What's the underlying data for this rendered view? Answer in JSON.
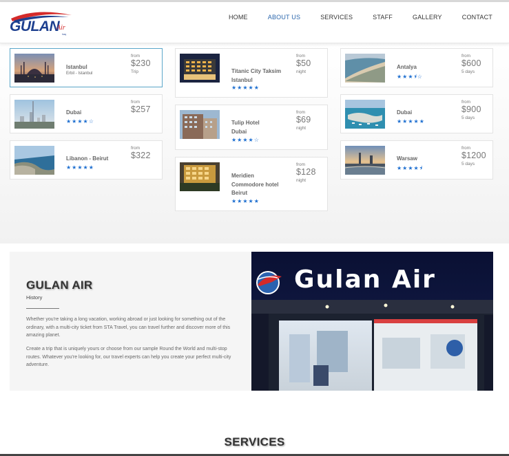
{
  "logo": {
    "text": "GULAN",
    "script": "Air",
    "tag": "Iraq"
  },
  "nav": [
    {
      "label": "HOME"
    },
    {
      "label": "ABOUT US",
      "active": true
    },
    {
      "label": "SERVICES"
    },
    {
      "label": "STAFF"
    },
    {
      "label": "GALLERY"
    },
    {
      "label": "CONTACT"
    }
  ],
  "deals": [
    {
      "name": "Istanbul",
      "sub": "Erbil - Istanbul",
      "from": "from",
      "price": "$230",
      "unit": "Trip",
      "rating": null,
      "selected": true,
      "image": "mosque"
    },
    {
      "name": "Dubai",
      "from": "from",
      "price": "$257",
      "unit": "",
      "rating": 4,
      "image": "dubai-skyline"
    },
    {
      "name": "Libanon - Beirut",
      "from": "from",
      "price": "$322",
      "unit": "",
      "rating": 5,
      "image": "coast"
    },
    {
      "name": "Titanic City Taksim\nIstanbul",
      "from": "from",
      "price": "$50",
      "unit": "night",
      "rating": 5,
      "image": "hotel-night"
    },
    {
      "name": "Tulip Hotel\nDubai",
      "from": "from",
      "price": "$69",
      "unit": "night",
      "rating": 4,
      "image": "hotel-building"
    },
    {
      "name": "Meridien\nCommodore hotel\nBeirut",
      "from": "from",
      "price": "$128",
      "unit": "night",
      "rating": 5,
      "image": "hotel-lit"
    },
    {
      "name": "Antalya",
      "from": "from",
      "price": "$600",
      "unit": "5 days",
      "rating": 3.5,
      "image": "beach"
    },
    {
      "name": "Dubai",
      "from": "from",
      "price": "$900",
      "unit": "5 days",
      "rating": 5,
      "image": "marina"
    },
    {
      "name": "Warsaw",
      "from": "from",
      "price": "$1200",
      "unit": "5 days",
      "rating": 4.5,
      "image": "city-sunset"
    }
  ],
  "about": {
    "title": "GULAN AIR",
    "subtitle": "History",
    "p1": "Whether you're taking a long vacation, working abroad or just looking for something out of the ordinary, with a multi-city ticket from STA Travel, you can travel further and discover more of this amazing planet.",
    "p2": "Create a trip that is uniquely yours or choose from our sample Round the World and multi-stop routes. Whatever you're looking for, our travel experts can help you create your perfect multi-city adventure.",
    "photo_sign": "Gulan Air"
  },
  "services_heading": "SERVICES",
  "colors": {
    "accent": "#2b67ad",
    "star": "#1e6fd0",
    "selected_border": "#5aa6c9",
    "logo_red": "#d42a2a",
    "logo_blue": "#1d3f8f"
  }
}
